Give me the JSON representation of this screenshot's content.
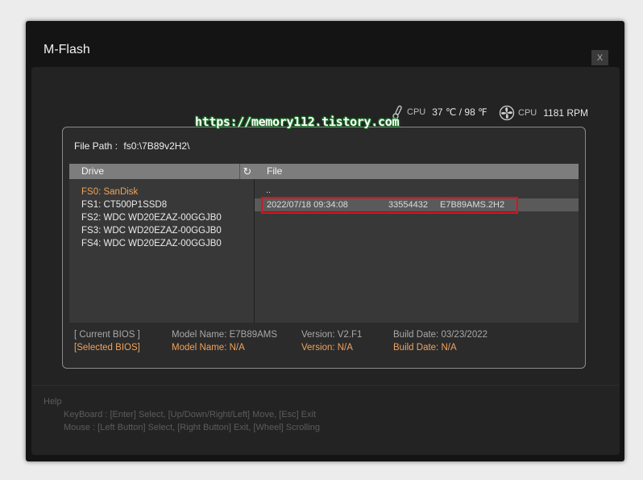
{
  "window": {
    "title": "M-Flash",
    "close_label": "X"
  },
  "watermark": "https://memory112.tistory.com",
  "sensors": {
    "cpu_temp": {
      "label": "CPU",
      "value": "37 ℃ / 98 ℉"
    },
    "cpu_fan": {
      "label": "CPU",
      "value": "1181 RPM"
    }
  },
  "file_path": {
    "label": "File Path :",
    "value": "fs0:\\7B89v2H2\\"
  },
  "drive_panel": {
    "header": "Drive",
    "refresh_icon": "↻",
    "items": [
      "FS0: SanDisk",
      "FS1: CT500P1SSD8",
      "FS2: WDC WD20EZAZ-00GGJB0",
      "FS3: WDC WD20EZAZ-00GGJB0",
      "FS4: WDC WD20EZAZ-00GGJB0"
    ]
  },
  "file_panel": {
    "header": "File",
    "parent": "..",
    "files": [
      {
        "date": "2022/07/18 09:34:08",
        "size": "33554432",
        "name": "E7B89AMS.2H2"
      }
    ]
  },
  "bios": {
    "current": {
      "label": "[ Current BIOS  ]",
      "model": "Model Name: E7B89AMS",
      "version": "Version: V2.F1",
      "build": "Build Date: 03/23/2022"
    },
    "selected": {
      "label": "[Selected BIOS]",
      "model": "Model Name: N/A",
      "version": "Version: N/A",
      "build": "Build Date: N/A"
    }
  },
  "help": {
    "title": "Help",
    "keyboard": "KeyBoard :  [Enter]  Select,   [Up/Down/Right/Left]  Move,   [Esc]  Exit",
    "mouse": "Mouse    :  [Left Button]  Select,   [Right Button]  Exit,   [Wheel]  Scrolling"
  },
  "colors": {
    "accent": "#f1a35c",
    "highlight_border": "#e0101a",
    "watermark_glow": "#1d7a2a"
  }
}
